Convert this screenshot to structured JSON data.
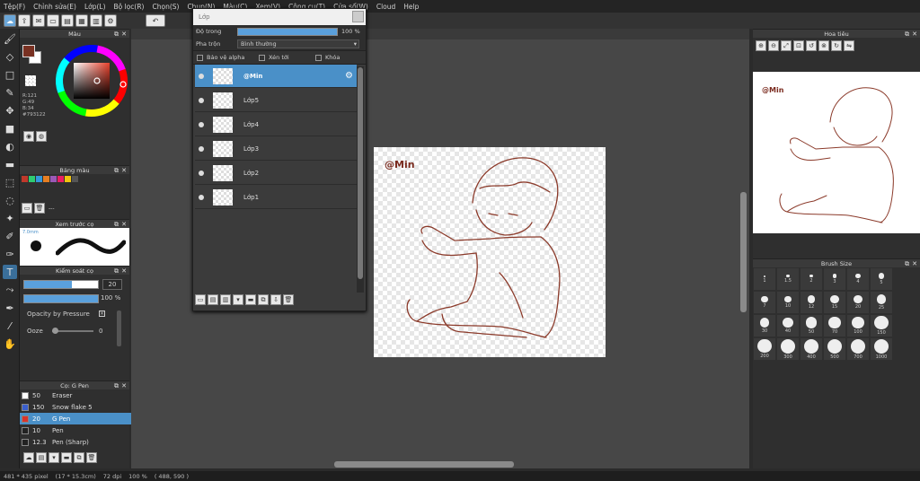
{
  "menu": [
    "Tệp(F)",
    "Chỉnh sửa(E)",
    "Lớp(L)",
    "Bộ lọc(R)",
    "Chọn(S)",
    "Chụp(N)",
    "Màu(C)",
    "Xem(V)",
    "Công cụ(T)",
    "Cửa sổ(W)",
    "Cloud",
    "Help"
  ],
  "color_panel": {
    "title": "Màu",
    "hex": "#793122",
    "values": [
      "R:121",
      "G:49",
      "B:34"
    ],
    "accent": "#793122"
  },
  "swatch_panel": {
    "title": "Bảng màu",
    "footer": "---",
    "colors": [
      "#c0392b",
      "#2ecc71",
      "#3498db",
      "#e67e22",
      "#9b59b6",
      "#e91e63",
      "#f1c40f",
      "#555555"
    ]
  },
  "brush_preview": {
    "title": "Xem trước cọ",
    "size_label": "7.0mm"
  },
  "brush_control": {
    "title": "Kiểm soát cọ",
    "size_value": "20",
    "opacity_value": "100 %",
    "pressure_label": "Opacity by Pressure",
    "ooze_label": "Ooze",
    "ooze_value": "0",
    "size_fill": 0.65,
    "opacity_fill": 1.0
  },
  "brush_list": {
    "title": "Cọ: G Pen",
    "items": [
      {
        "size": "50",
        "name": "Eraser",
        "color": "#ffffff"
      },
      {
        "size": "150",
        "name": "Snow flake 5",
        "color": "#3a5fcd"
      },
      {
        "size": "20",
        "name": "G Pen",
        "color": "#d9342b",
        "selected": true
      },
      {
        "size": "10",
        "name": "Pen",
        "color": "#222222"
      },
      {
        "size": "12.3",
        "name": "Pen (Sharp)",
        "color": "#222222"
      }
    ]
  },
  "layer_window": {
    "title": "Lớp",
    "opacity_label": "Độ trong",
    "opacity_value": "100 %",
    "opacity_fill": 1.0,
    "blend_label": "Pha trộn",
    "blend_value": "Bình thường",
    "protect_alpha": "Bảo vệ alpha",
    "clipping": "Xén tới",
    "lock": "Khóa",
    "layers": [
      {
        "name": "@Min",
        "selected": true
      },
      {
        "name": "Lớp5"
      },
      {
        "name": "Lớp4"
      },
      {
        "name": "Lớp3"
      },
      {
        "name": "Lớp2"
      },
      {
        "name": "Lớp1"
      }
    ]
  },
  "canvas": {
    "signature": "@Min",
    "line_color": "#8b3a2a"
  },
  "navigator": {
    "title": "Hoa tiêu",
    "signature": "@Min"
  },
  "brush_size": {
    "title": "Brush Size",
    "sizes": [
      "1",
      "1.5",
      "2",
      "3",
      "4",
      "5",
      "7",
      "10",
      "12",
      "15",
      "20",
      "25",
      "30",
      "40",
      "50",
      "70",
      "100",
      "150",
      "200",
      "300",
      "400",
      "500",
      "700",
      "1000"
    ]
  },
  "status": {
    "dims": "481 * 435 pixel",
    "physical": "(17 * 15.3cm)",
    "dpi": "72 dpi",
    "zoom": "100 %",
    "coords": "( 488, 590 )"
  }
}
